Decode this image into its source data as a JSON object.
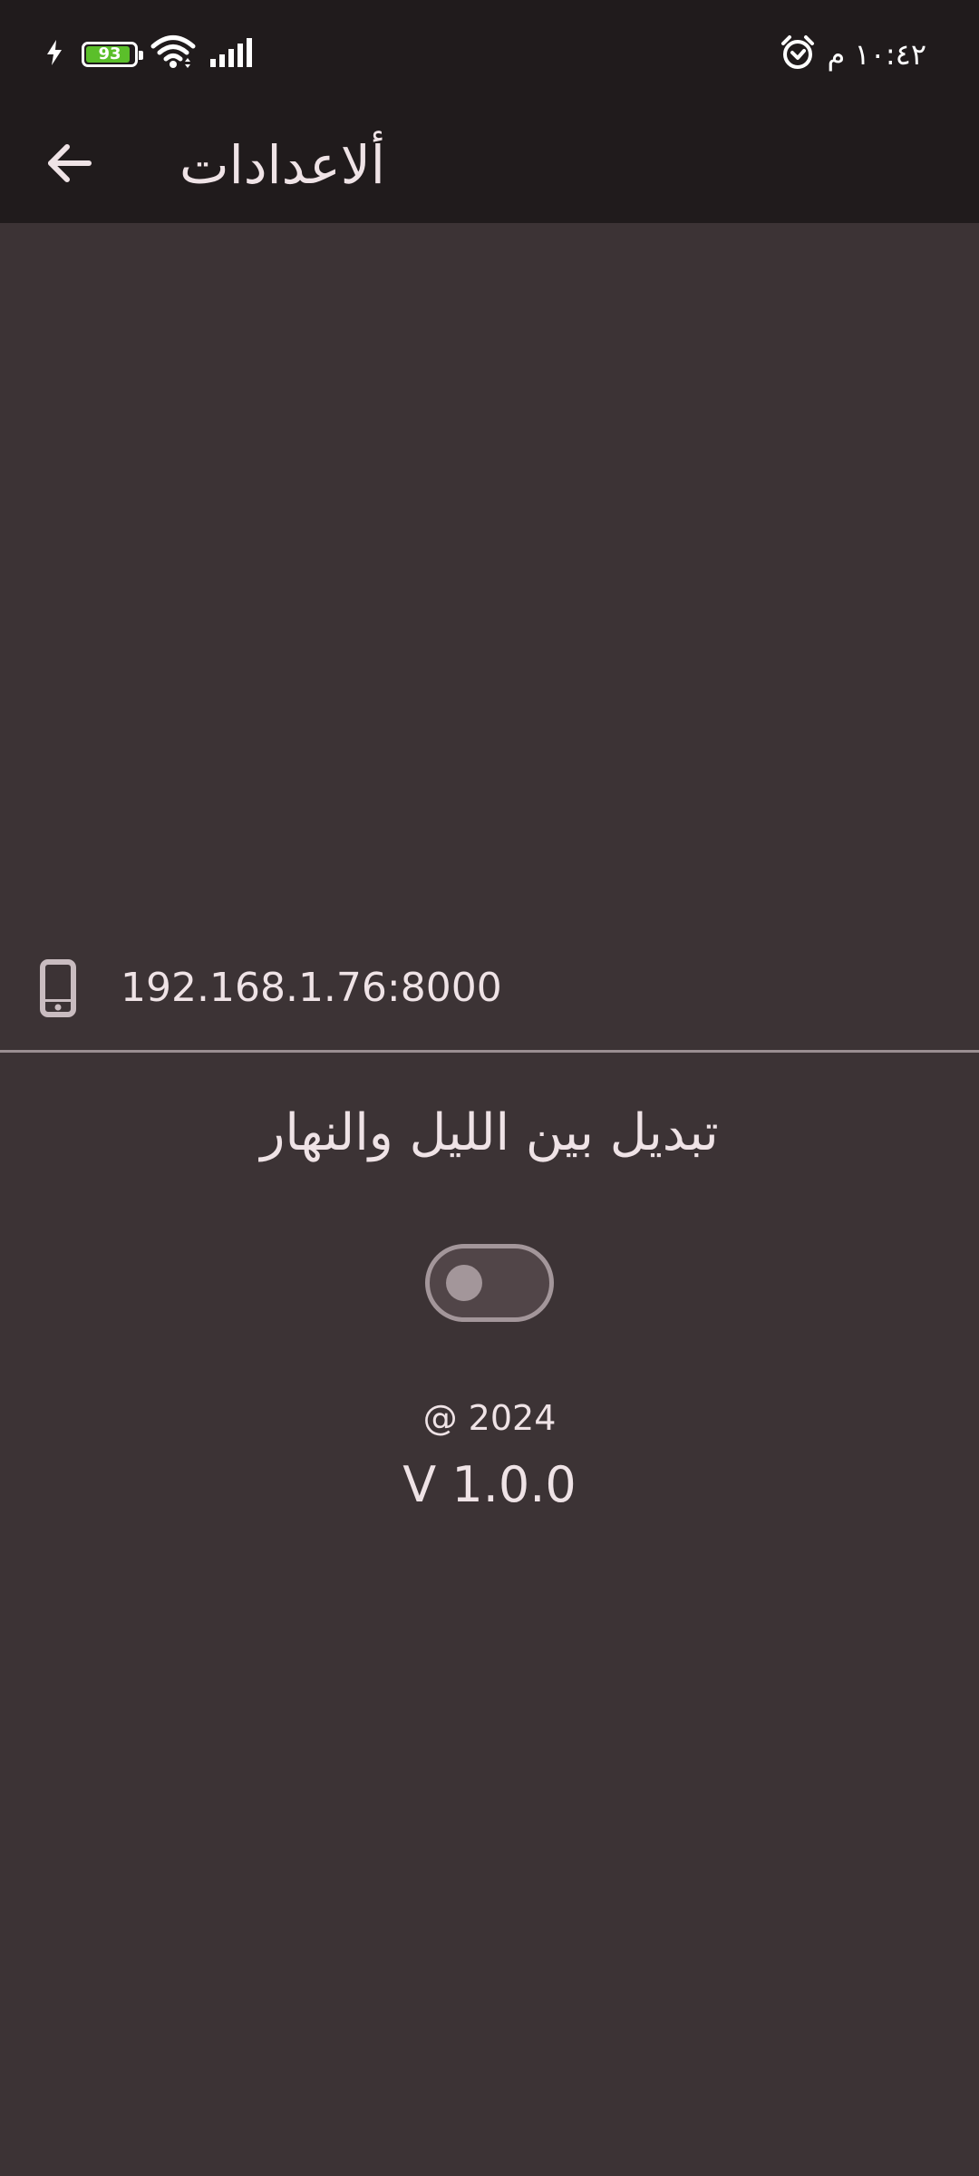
{
  "status_bar": {
    "time": "١٠:٤٢ م",
    "battery_level": "93",
    "battery_fraction": 0.93,
    "battery_color": "#5bbf2a",
    "icons": [
      "charging-bolt-icon",
      "battery-icon",
      "wifi-icon",
      "cell-signal-icon",
      "alarm-icon"
    ]
  },
  "app_bar": {
    "title": "ألاعدادات",
    "back_icon": "back-arrow-icon"
  },
  "server": {
    "icon": "smartphone-icon",
    "address": "192.168.1.76:8000"
  },
  "theme": {
    "label": "تبديل بين الليل والنهار",
    "toggle_on": false
  },
  "footer": {
    "copyright": "@ 2024",
    "version": "V 1.0.0"
  },
  "colors": {
    "background": "#3c3335",
    "bars": "#201b1c",
    "text": "#efe3e6",
    "switch_track": "#514548",
    "switch_outline": "#a3969a"
  }
}
